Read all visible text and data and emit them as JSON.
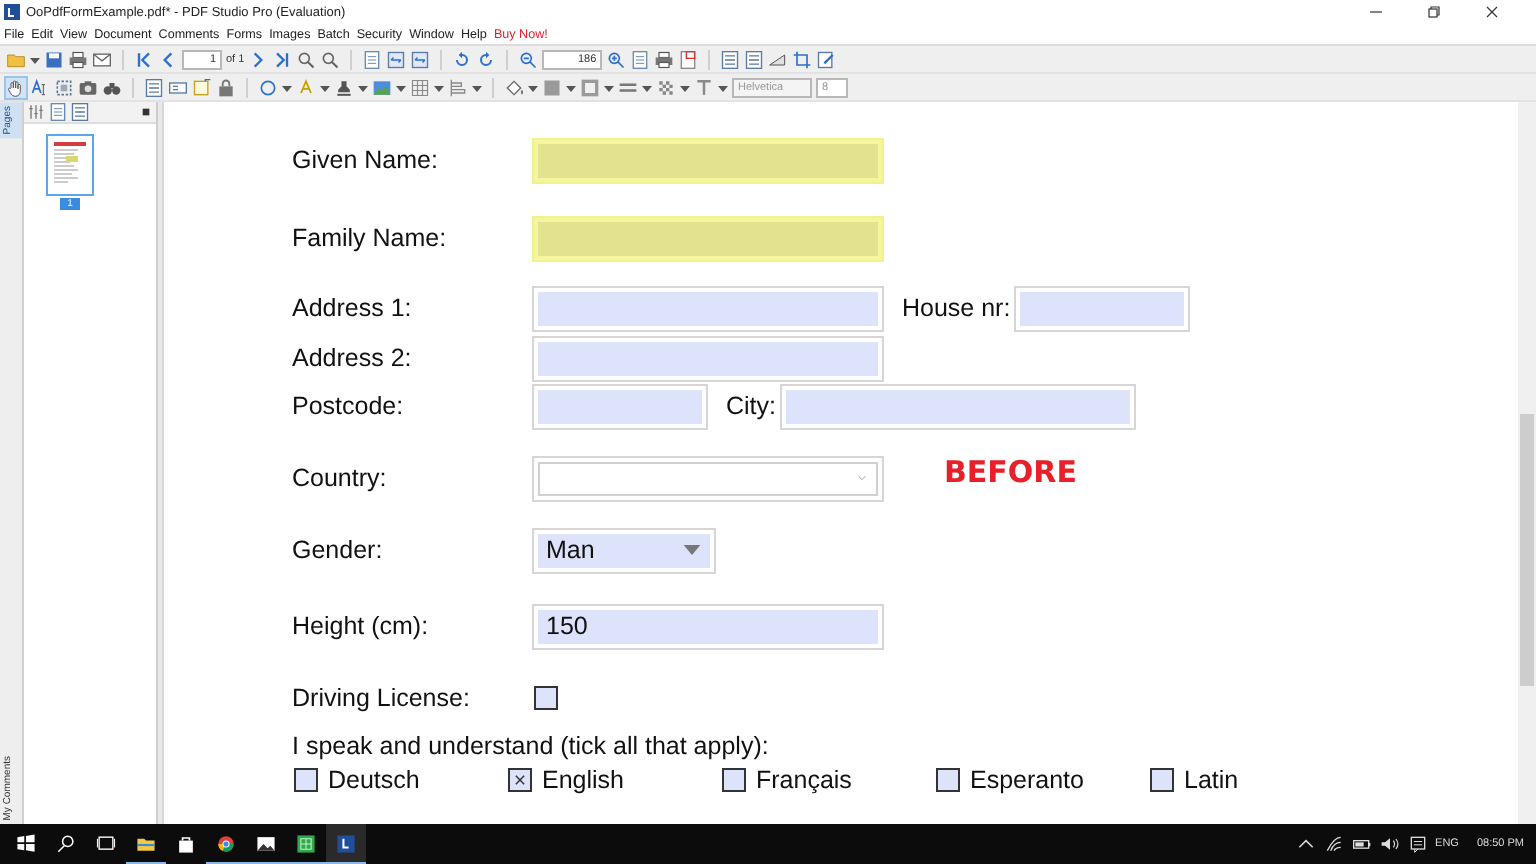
{
  "window": {
    "title": "OoPdfFormExample.pdf* - PDF Studio Pro (Evaluation)"
  },
  "menu": [
    {
      "label": "File",
      "kind": "normal"
    },
    {
      "label": "Edit",
      "kind": "normal"
    },
    {
      "label": "View",
      "kind": "normal"
    },
    {
      "label": "Document",
      "kind": "normal"
    },
    {
      "label": "Comments",
      "kind": "normal"
    },
    {
      "label": "Forms",
      "kind": "normal"
    },
    {
      "label": "Images",
      "kind": "normal"
    },
    {
      "label": "Batch",
      "kind": "normal"
    },
    {
      "label": "Security",
      "kind": "normal"
    },
    {
      "label": "Window",
      "kind": "normal"
    },
    {
      "label": "Help",
      "kind": "normal"
    },
    {
      "label": "Buy Now!",
      "kind": "promo"
    }
  ],
  "toolbar": {
    "page_field": "1",
    "page_count": "of 1",
    "zoom_field": "186",
    "font_field": "Helvetica",
    "font_size_field": "8"
  },
  "side_tabs": [
    {
      "label": "Pages",
      "selected": true
    },
    {
      "label": "My Comments",
      "selected": false
    }
  ],
  "thumbnails": [
    {
      "label": "1",
      "selected": true
    }
  ],
  "form": {
    "rows": [
      {
        "kind": "text",
        "label": "Given Name:",
        "required": true
      },
      {
        "kind": "text",
        "label": "Family Name:",
        "required": true
      },
      {
        "kind": "address",
        "label": "Address 1:",
        "label_2": "House nr:"
      },
      {
        "kind": "text",
        "label": "Address 2:",
        "required": false
      },
      {
        "kind": "postcode",
        "label": "Postcode:",
        "label_2": "City:"
      },
      {
        "kind": "combo",
        "label": "Country:",
        "note": "BEFORE"
      },
      {
        "kind": "combo",
        "label": "Gender:",
        "value": "Man"
      },
      {
        "kind": "text",
        "label": "Height (cm):",
        "value": "150",
        "required": false
      },
      {
        "kind": "checkbox",
        "label": "Driving License:",
        "checked": false
      },
      {
        "kind": "group",
        "label": "I speak and understand (tick all that apply):",
        "options": [
          {
            "label": "Deutsch",
            "checked": false
          },
          {
            "label": "English",
            "checked": true
          },
          {
            "label": "Français",
            "checked": false
          },
          {
            "label": "Esperanto",
            "checked": false
          },
          {
            "label": "Latin",
            "checked": false
          }
        ]
      }
    ]
  },
  "taskbar": {
    "language": "ENG",
    "clock": "08:50 PM"
  }
}
